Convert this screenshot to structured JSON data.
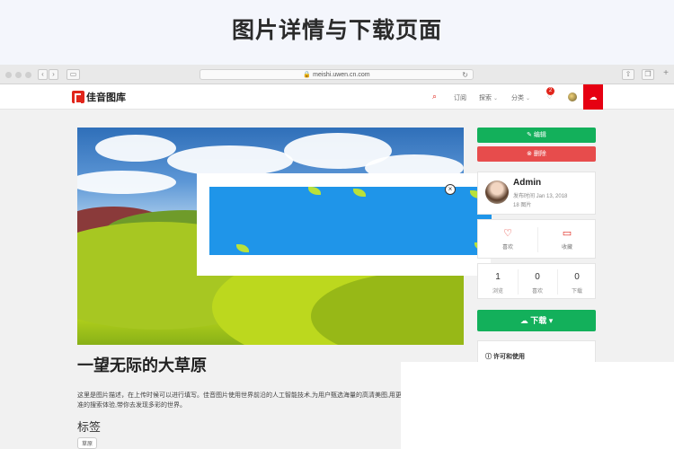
{
  "banner": {
    "title": "图片详情与下载页面"
  },
  "browser": {
    "url": "meishi.uwen.cn.com"
  },
  "site": {
    "logo_text": "佳音图库",
    "nav": {
      "subscribe": "订阅",
      "explore": "探索",
      "category": "分类",
      "notification_count": "2"
    }
  },
  "image": {
    "title": "一望无际的大草原",
    "description": "这里是图片描述，在上传时候可以进行填写。佳音图片使用世界前沿的人工智能技术,为用户甄选海量的高清美图,用更精准的搜索体验,带你去发现多彩的世界。",
    "tags_heading": "标签",
    "tags": [
      "草原"
    ]
  },
  "actions": {
    "edit": "编辑",
    "delete": "删除",
    "download": "下载"
  },
  "author": {
    "name": "Admin",
    "published": "发布时间 Jan 13, 2018",
    "image_count": "18 图片"
  },
  "social": {
    "like": "喜欢",
    "collect": "收藏"
  },
  "stats": [
    {
      "num": "1",
      "label": "浏览"
    },
    {
      "num": "0",
      "label": "喜欢"
    },
    {
      "num": "0",
      "label": "下载"
    }
  ],
  "license": {
    "title": "许可和使用"
  },
  "colors": {
    "brand_red": "#e60012",
    "green": "#13b05b",
    "delete_red": "#e74c4c",
    "ad_blue": "#1f95e9"
  }
}
